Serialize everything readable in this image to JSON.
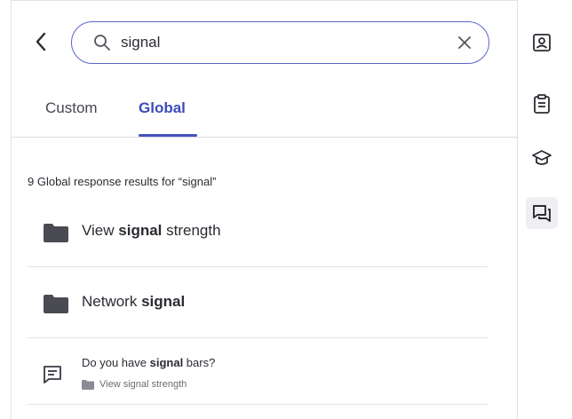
{
  "search": {
    "query": "signal",
    "placeholder": ""
  },
  "tabs": [
    {
      "label": "Custom",
      "active": false
    },
    {
      "label": "Global",
      "active": true
    }
  ],
  "results": {
    "count_text": "9 Global response results for “signal”",
    "folders": [
      {
        "pre": "View ",
        "match": "signal",
        "post": " strength",
        "icon": "folder-icon"
      },
      {
        "pre": "Network ",
        "match": "signal",
        "post": "",
        "icon": "folder-icon"
      }
    ],
    "responses": [
      {
        "pre": "Do you have ",
        "match": "signal",
        "post": " bars?",
        "folder": "View signal strength",
        "icon": "chat-message-icon"
      }
    ]
  },
  "rail": {
    "items": [
      {
        "icon": "contact-card-icon",
        "active": false
      },
      {
        "icon": "clipboard-icon",
        "active": false
      },
      {
        "icon": "graduation-cap-icon",
        "active": false
      },
      {
        "icon": "conversation-icon",
        "active": true
      }
    ]
  },
  "colors": {
    "accent": "#4452c0",
    "folder": "#4a4a52",
    "border": "#e3e3e8",
    "active_rail_bg": "#eeeef3"
  }
}
